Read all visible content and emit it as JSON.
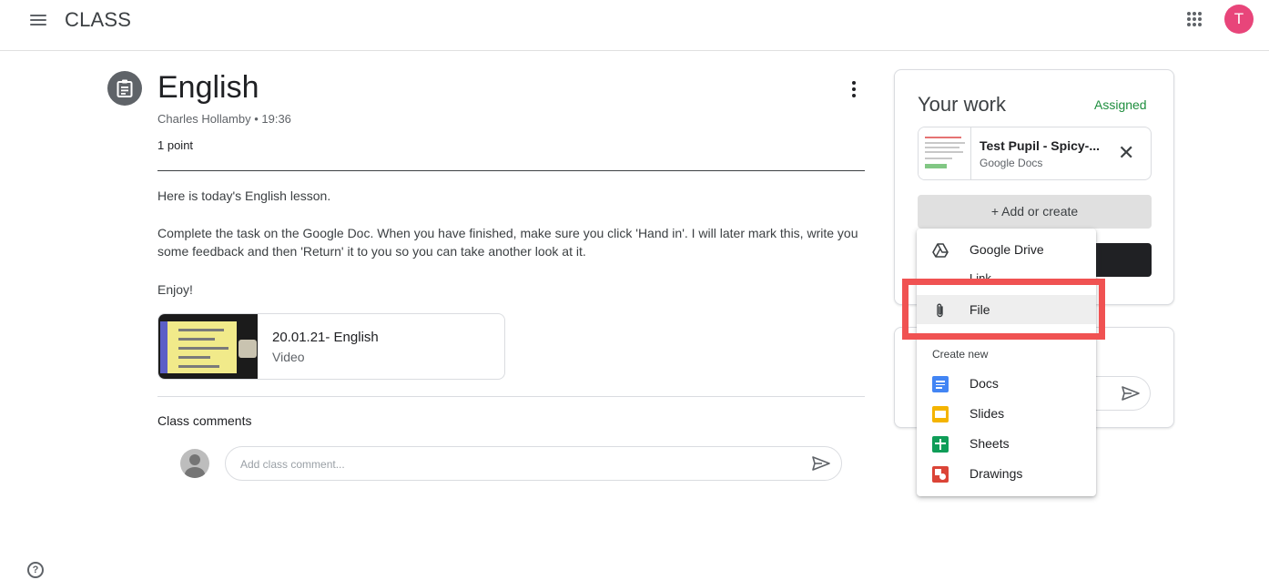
{
  "app": {
    "title": "CLASS",
    "avatar_initial": "T",
    "menu_icon": "hamburger-menu-icon",
    "apps_icon": "google-apps-grid-icon"
  },
  "assignment": {
    "icon": "assignment-clipboard-icon",
    "title": "English",
    "meta": "Charles Hollamby • 19:36",
    "points": "1 point",
    "description": [
      "Here is today's English lesson.",
      "Complete the task on the Google Doc. When you have finished, make sure you click 'Hand in'. I will later mark this, write you some feedback and then 'Return' it to you so you can take another look at it.",
      "Enjoy!"
    ],
    "attachment": {
      "title": "20.01.21- English",
      "type": "Video"
    }
  },
  "comments": {
    "label": "Class comments",
    "placeholder": "Add class comment..."
  },
  "your_work": {
    "title": "Your work",
    "status": "Assigned",
    "status_color": "#1e8e3e",
    "file": {
      "name": "Test Pupil - Spicy-...",
      "type": "Google Docs"
    },
    "add_button": "+ Add or create"
  },
  "add_menu": {
    "items": [
      {
        "label": "Google Drive",
        "icon": "google-drive-icon"
      },
      {
        "label": "Link",
        "icon": "link-icon"
      },
      {
        "label": "File",
        "icon": "paperclip-icon"
      }
    ],
    "create_new_label": "Create new",
    "create_items": [
      {
        "label": "Docs",
        "icon": "google-docs-icon",
        "color": "#4285f4"
      },
      {
        "label": "Slides",
        "icon": "google-slides-icon",
        "color": "#f4b400"
      },
      {
        "label": "Sheets",
        "icon": "google-sheets-icon",
        "color": "#0f9d58"
      },
      {
        "label": "Drawings",
        "icon": "google-drawings-icon",
        "color": "#db4437"
      }
    ]
  },
  "highlight_color": "#f05252",
  "help_icon": "help-circle-icon"
}
